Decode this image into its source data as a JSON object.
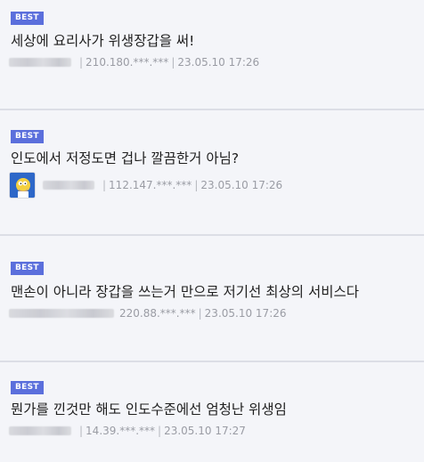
{
  "comments": [
    {
      "badge": "BEST",
      "text": "세상에 요리사가 위생장갑을 써!",
      "ip": "210.180.***.***",
      "date": "23.05.10 17:26"
    },
    {
      "badge": "BEST",
      "text": "인도에서 저정도면 겁나 깔끔한거 아님?",
      "ip": "112.147.***.***",
      "date": "23.05.10 17:26"
    },
    {
      "badge": "BEST",
      "text": "맨손이 아니라 장갑을 쓰는거 만으로 저기선 최상의 서비스다",
      "ip": "220.88.***.***",
      "date": "23.05.10 17:26"
    },
    {
      "badge": "BEST",
      "text": "뭔가를 낀것만 해도 인도수준에선 엄청난 위생임",
      "ip": "14.39.***.***",
      "date": "23.05.10 17:27"
    }
  ],
  "colors": {
    "badge": "#5b6fdc",
    "background": "#f4f5f9",
    "divider": "#dcdee6",
    "meta_text": "#9a9ca4"
  },
  "icons": {
    "avatar": "cartoon-character-avatar"
  }
}
